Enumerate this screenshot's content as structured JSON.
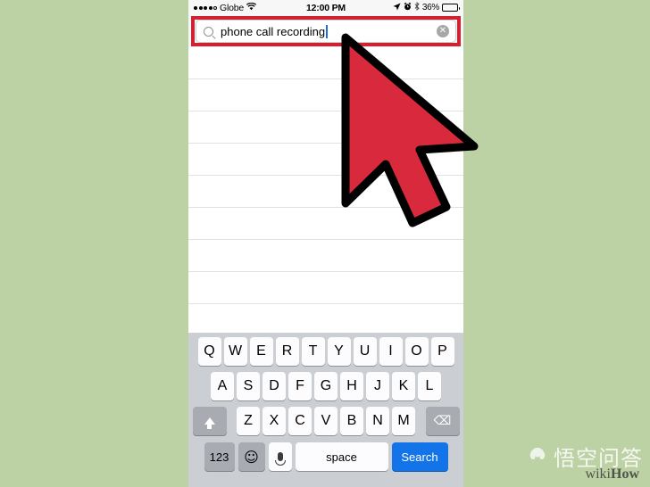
{
  "background_color": "#bcd1a4",
  "accent_red": "#cf2233",
  "accent_blue": "#1274e8",
  "status_bar": {
    "signal_dots_filled": 4,
    "signal_dots_empty": 1,
    "carrier": "Globe",
    "wifi_icon": "wifi-icon",
    "time": "12:00 PM",
    "location_icon": "location-arrow-icon",
    "alarm_icon": "alarm-clock-icon",
    "bluetooth_icon": "bluetooth-icon",
    "battery_percent": "36%",
    "battery_icon": "battery-icon"
  },
  "search": {
    "magnifier_icon": "search-icon",
    "value": "phone call recording",
    "placeholder": "Search",
    "clear_icon": "✕",
    "clear_label": "clear-text-button"
  },
  "results": {
    "row_count": 9,
    "rows": []
  },
  "keyboard": {
    "row1": [
      "Q",
      "W",
      "E",
      "R",
      "T",
      "Y",
      "U",
      "I",
      "O",
      "P"
    ],
    "row2": [
      "A",
      "S",
      "D",
      "F",
      "G",
      "H",
      "J",
      "K",
      "L"
    ],
    "row3": [
      "Z",
      "X",
      "C",
      "V",
      "B",
      "N",
      "M"
    ],
    "shift_icon": "shift-arrow-icon",
    "backspace_icon": "⌫",
    "numbers_label": "123",
    "emoji_icon": "☺",
    "mic_icon": "microphone-icon",
    "space_label": "space",
    "search_label": "Search"
  },
  "cursor": {
    "icon": "mouse-pointer-icon",
    "fill": "#d9293c",
    "stroke": "#000000"
  },
  "watermark": {
    "chinese": "悟空问答",
    "logo_icon": "wukong-logo-icon",
    "wiki": "wiki",
    "how": "How"
  }
}
